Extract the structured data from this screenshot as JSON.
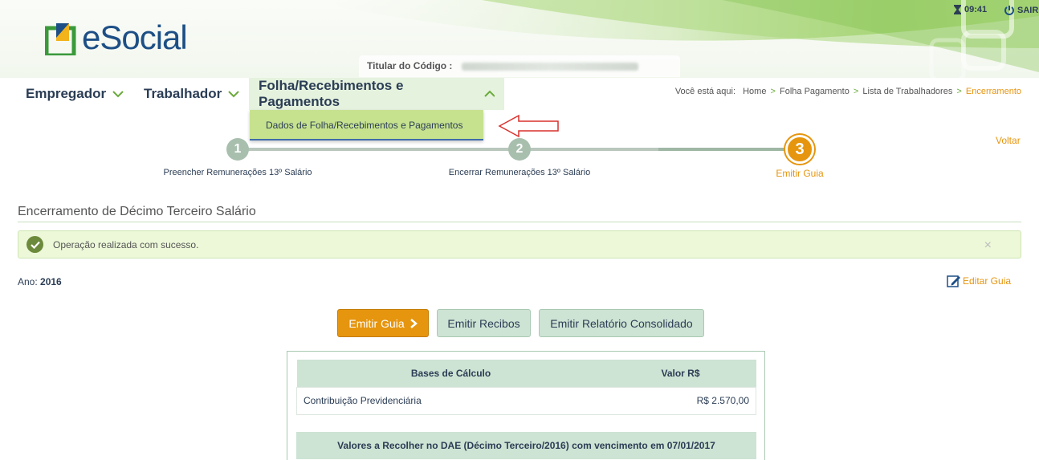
{
  "app": {
    "logo_text": "eSocial",
    "titular_label": "Titular do Código :",
    "clock": "09:41",
    "logout": "SAIR"
  },
  "colors": {
    "brand_blue": "#1d4f86",
    "accent_orange": "#e6950e",
    "green_light": "#c6e28f",
    "table_header": "#cde3d3"
  },
  "nav": {
    "items": [
      {
        "label": "Empregador"
      },
      {
        "label": "Trabalhador"
      },
      {
        "label": "Folha/Recebimentos e Pagamentos"
      }
    ],
    "dropdown_item": "Dados de Folha/Recebimentos e Pagamentos"
  },
  "breadcrumb": {
    "label": "Você está aqui:",
    "items": [
      "Home",
      "Folha Pagamento",
      "Lista de Trabalhadores",
      "Encerramento"
    ]
  },
  "steps": [
    {
      "number": "1",
      "label": "Preencher Remunerações 13º Salário"
    },
    {
      "number": "2",
      "label": "Encerrar Remunerações 13º Salário"
    },
    {
      "number": "3",
      "label": "Emitir Guia"
    }
  ],
  "voltar": "Voltar",
  "page_title": "Encerramento de Décimo Terceiro Salário",
  "alert": {
    "message": "Operação realizada com sucesso.",
    "close": "×"
  },
  "ano": {
    "label": "Ano:",
    "value": "2016"
  },
  "editar_guia": "Editar Guia",
  "buttons": {
    "emitir_guia": "Emitir Guia",
    "emitir_recibos": "Emitir Recibos",
    "emitir_relatorio": "Emitir Relatório Consolidado"
  },
  "table": {
    "headers": [
      "Bases de Cálculo",
      "Valor R$"
    ],
    "rows": [
      {
        "label": "Contribuição Previdenciária",
        "value": "R$ 2.570,00"
      }
    ],
    "section_title": "Valores a Recolher no DAE (Décimo Terceiro/2016) com vencimento em 07/01/2017"
  }
}
